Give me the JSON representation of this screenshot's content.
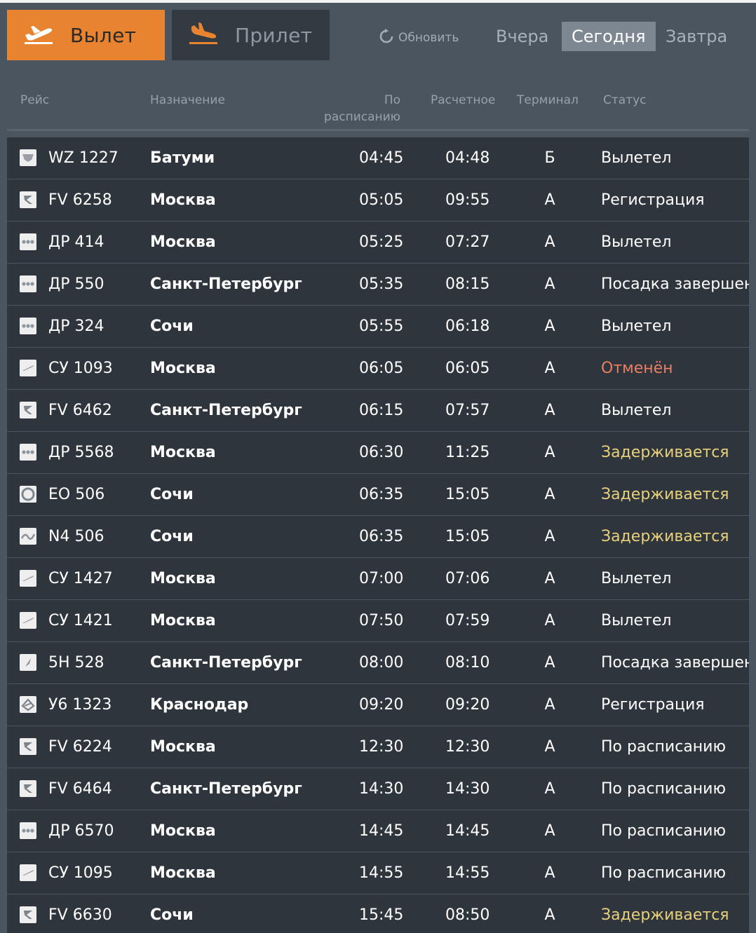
{
  "mode_tabs": {
    "departures_label": "Вылет",
    "departures_icon": "plane-takeoff-icon",
    "arrivals_label": "Прилет",
    "arrivals_icon": "plane-landing-icon"
  },
  "refresh": {
    "label": "Обновить",
    "icon": "refresh-icon"
  },
  "day_tabs": {
    "yesterday": "Вчера",
    "today": "Сегодня",
    "tomorrow": "Завтра",
    "selected": "today"
  },
  "columns": {
    "flight": "Рейс",
    "destination": "Назначение",
    "scheduled_line1": "По",
    "scheduled_line2": "расписанию",
    "estimated": "Расчетное",
    "terminal": "Терминал",
    "status": "Статус"
  },
  "colors": {
    "accent": "#e8832f",
    "cancelled": "#ea7e63",
    "delayed": "#e8cf7a",
    "row_bg": "#2f353c",
    "page_bg": "#4b5560"
  },
  "flights": [
    {
      "logo": "airline-logo-wz",
      "flight": "WZ 1227",
      "destination": "Батуми",
      "scheduled": "04:45",
      "estimated": "04:48",
      "terminal": "Б",
      "status": "Вылетел",
      "state": "normal"
    },
    {
      "logo": "airline-logo-fv",
      "flight": "FV 6258",
      "destination": "Москва",
      "scheduled": "05:05",
      "estimated": "09:55",
      "terminal": "А",
      "status": "Регистрация",
      "state": "normal"
    },
    {
      "logo": "airline-logo-dp",
      "flight": "ДР 414",
      "destination": "Москва",
      "scheduled": "05:25",
      "estimated": "07:27",
      "terminal": "А",
      "status": "Вылетел",
      "state": "normal"
    },
    {
      "logo": "airline-logo-dp",
      "flight": "ДР 550",
      "destination": "Санкт-Петербург",
      "scheduled": "05:35",
      "estimated": "08:15",
      "terminal": "А",
      "status": "Посадка завершена",
      "state": "normal"
    },
    {
      "logo": "airline-logo-dp",
      "flight": "ДР 324",
      "destination": "Сочи",
      "scheduled": "05:55",
      "estimated": "06:18",
      "terminal": "А",
      "status": "Вылетел",
      "state": "normal"
    },
    {
      "logo": "airline-logo-su",
      "flight": "СУ 1093",
      "destination": "Москва",
      "scheduled": "06:05",
      "estimated": "06:05",
      "terminal": "А",
      "status": "Отменён",
      "state": "cancelled"
    },
    {
      "logo": "airline-logo-fv",
      "flight": "FV 6462",
      "destination": "Санкт-Петербург",
      "scheduled": "06:15",
      "estimated": "07:57",
      "terminal": "А",
      "status": "Вылетел",
      "state": "normal"
    },
    {
      "logo": "airline-logo-dp",
      "flight": "ДР 5568",
      "destination": "Москва",
      "scheduled": "06:30",
      "estimated": "11:25",
      "terminal": "А",
      "status": "Задерживается",
      "state": "delayed"
    },
    {
      "logo": "airline-logo-eo",
      "flight": "EO 506",
      "destination": "Сочи",
      "scheduled": "06:35",
      "estimated": "15:05",
      "terminal": "А",
      "status": "Задерживается",
      "state": "delayed"
    },
    {
      "logo": "airline-logo-n4",
      "flight": "N4 506",
      "destination": "Сочи",
      "scheduled": "06:35",
      "estimated": "15:05",
      "terminal": "А",
      "status": "Задерживается",
      "state": "delayed"
    },
    {
      "logo": "airline-logo-su",
      "flight": "СУ 1427",
      "destination": "Москва",
      "scheduled": "07:00",
      "estimated": "07:06",
      "terminal": "А",
      "status": "Вылетел",
      "state": "normal"
    },
    {
      "logo": "airline-logo-su",
      "flight": "СУ 1421",
      "destination": "Москва",
      "scheduled": "07:50",
      "estimated": "07:59",
      "terminal": "А",
      "status": "Вылетел",
      "state": "normal"
    },
    {
      "logo": "airline-logo-5h",
      "flight": "5Н 528",
      "destination": "Санкт-Петербург",
      "scheduled": "08:00",
      "estimated": "08:10",
      "terminal": "А",
      "status": "Посадка завершена",
      "state": "normal"
    },
    {
      "logo": "airline-logo-u6",
      "flight": "У6 1323",
      "destination": "Краснодар",
      "scheduled": "09:20",
      "estimated": "09:20",
      "terminal": "А",
      "status": "Регистрация",
      "state": "normal"
    },
    {
      "logo": "airline-logo-fv",
      "flight": "FV 6224",
      "destination": "Москва",
      "scheduled": "12:30",
      "estimated": "12:30",
      "terminal": "А",
      "status": "По расписанию",
      "state": "normal"
    },
    {
      "logo": "airline-logo-fv",
      "flight": "FV 6464",
      "destination": "Санкт-Петербург",
      "scheduled": "14:30",
      "estimated": "14:30",
      "terminal": "А",
      "status": "По расписанию",
      "state": "normal"
    },
    {
      "logo": "airline-logo-dp",
      "flight": "ДР 6570",
      "destination": "Москва",
      "scheduled": "14:45",
      "estimated": "14:45",
      "terminal": "А",
      "status": "По расписанию",
      "state": "normal"
    },
    {
      "logo": "airline-logo-su",
      "flight": "СУ 1095",
      "destination": "Москва",
      "scheduled": "14:55",
      "estimated": "14:55",
      "terminal": "А",
      "status": "По расписанию",
      "state": "normal"
    },
    {
      "logo": "airline-logo-fv",
      "flight": "FV 6630",
      "destination": "Сочи",
      "scheduled": "15:45",
      "estimated": "08:50",
      "terminal": "А",
      "status": "Задерживается",
      "state": "delayed"
    }
  ]
}
